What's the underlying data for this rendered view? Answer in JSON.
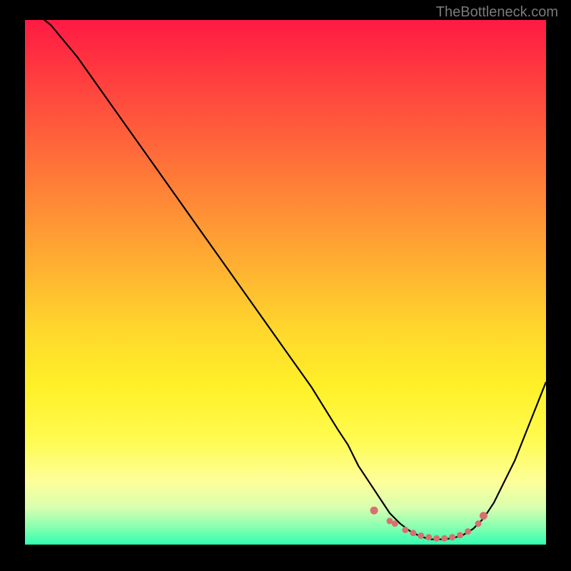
{
  "watermark": "TheBottleneck.com",
  "chart_data": {
    "type": "line",
    "title": "",
    "xlabel": "",
    "ylabel": "",
    "xlim": [
      0,
      100
    ],
    "ylim": [
      0,
      100
    ],
    "series": [
      {
        "name": "bottleneck-curve",
        "x": [
          0,
          5,
          10,
          15,
          20,
          25,
          30,
          35,
          40,
          45,
          50,
          55,
          60,
          62,
          64,
          66,
          68,
          70,
          72,
          74,
          76,
          78,
          80,
          82,
          84,
          86,
          88,
          90,
          92,
          94,
          96,
          98,
          100
        ],
        "y": [
          103,
          99,
          93,
          86,
          79,
          72,
          65,
          58,
          51,
          44,
          37,
          30,
          22,
          19,
          15,
          12,
          9,
          6,
          4,
          2.5,
          1.5,
          1,
          1,
          1.2,
          1.8,
          3,
          5,
          8,
          12,
          16,
          21,
          26,
          31
        ]
      }
    ],
    "highlight_points": {
      "name": "optimal-range",
      "x": [
        67,
        70,
        71,
        73,
        74.5,
        76,
        77.5,
        79,
        80.5,
        82,
        83.5,
        85,
        87,
        88
      ],
      "y": [
        6.5,
        4.5,
        4,
        2.8,
        2.2,
        1.7,
        1.4,
        1.2,
        1.2,
        1.4,
        1.8,
        2.5,
        4,
        5.5
      ]
    },
    "background_gradient": {
      "top": "#ff1a44",
      "mid": "#ffda2c",
      "bottom": "#2fffb0"
    }
  }
}
